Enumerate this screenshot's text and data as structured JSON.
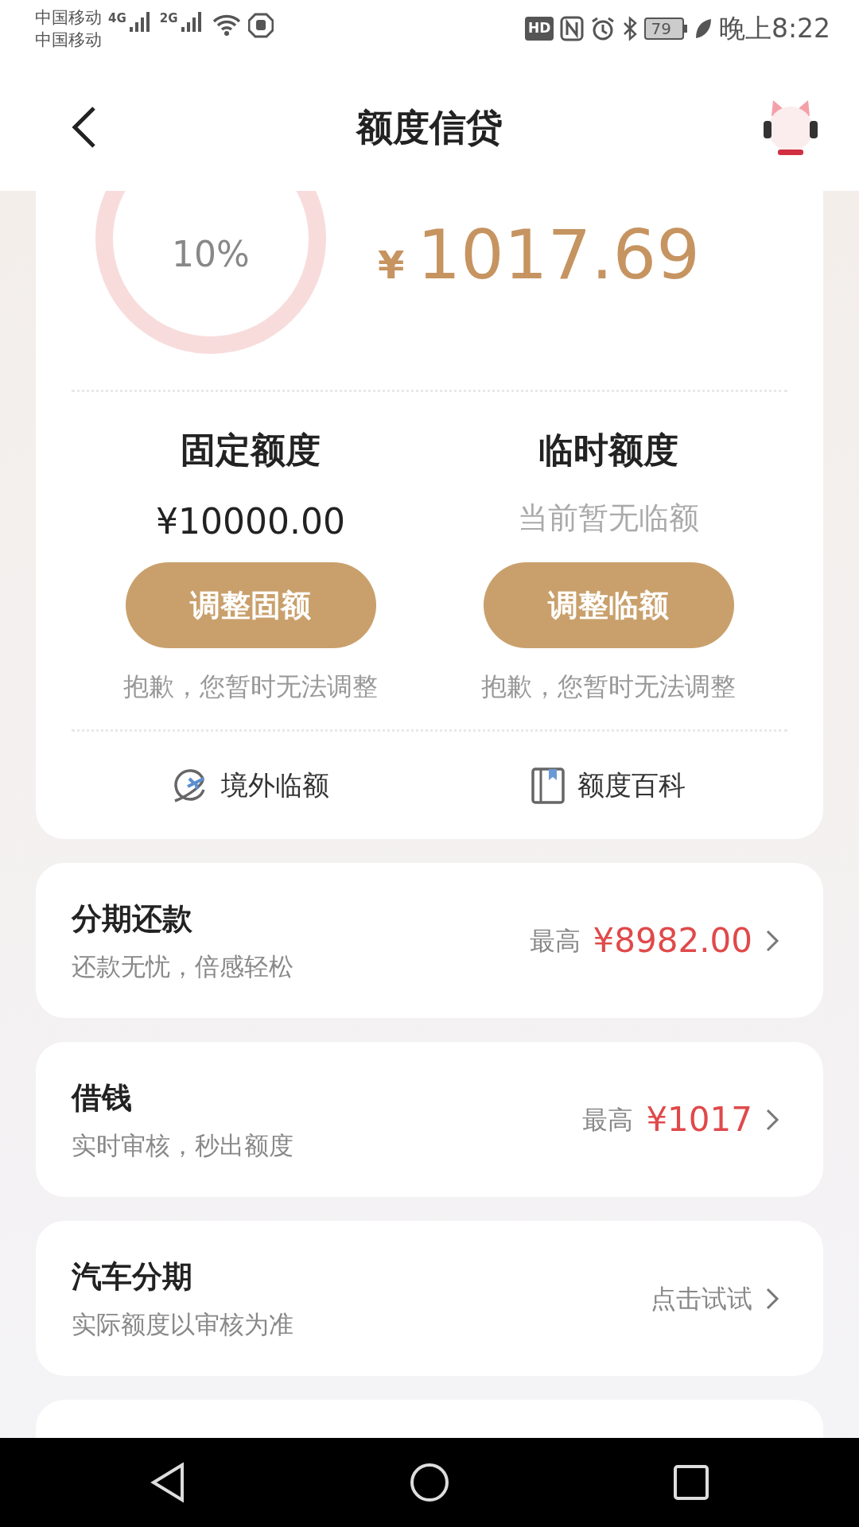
{
  "status_bar": {
    "carriers": [
      "中国移动",
      "中国移动"
    ],
    "networks": [
      "4G",
      "2G"
    ],
    "hd": "HD",
    "battery": "79",
    "time": "晚上8:22"
  },
  "header": {
    "title": "额度信贷"
  },
  "quota_card": {
    "ring_value": "10%",
    "currency": "¥",
    "amount": "1017.69",
    "columns": [
      {
        "title": "固定额度",
        "value": "¥10000.00",
        "muted": false,
        "button": "调整固额",
        "note": "抱歉，您暂时无法调整"
      },
      {
        "title": "临时额度",
        "value": "当前暂无临额",
        "muted": true,
        "button": "调整临额",
        "note": "抱歉，您暂时无法调整"
      }
    ],
    "links": [
      {
        "kind": "plane",
        "label": "境外临额"
      },
      {
        "kind": "book",
        "label": "额度百科"
      }
    ]
  },
  "products": [
    {
      "title": "分期还款",
      "subtitle": "还款无忧，倍感轻松",
      "prefix": "最高",
      "value": "¥8982.00"
    },
    {
      "title": "借钱",
      "subtitle": "实时审核，秒出额度",
      "prefix": "最高",
      "value": "¥1017"
    },
    {
      "title": "汽车分期",
      "subtitle": "实际额度以审核为准",
      "action": "点击试试"
    }
  ]
}
